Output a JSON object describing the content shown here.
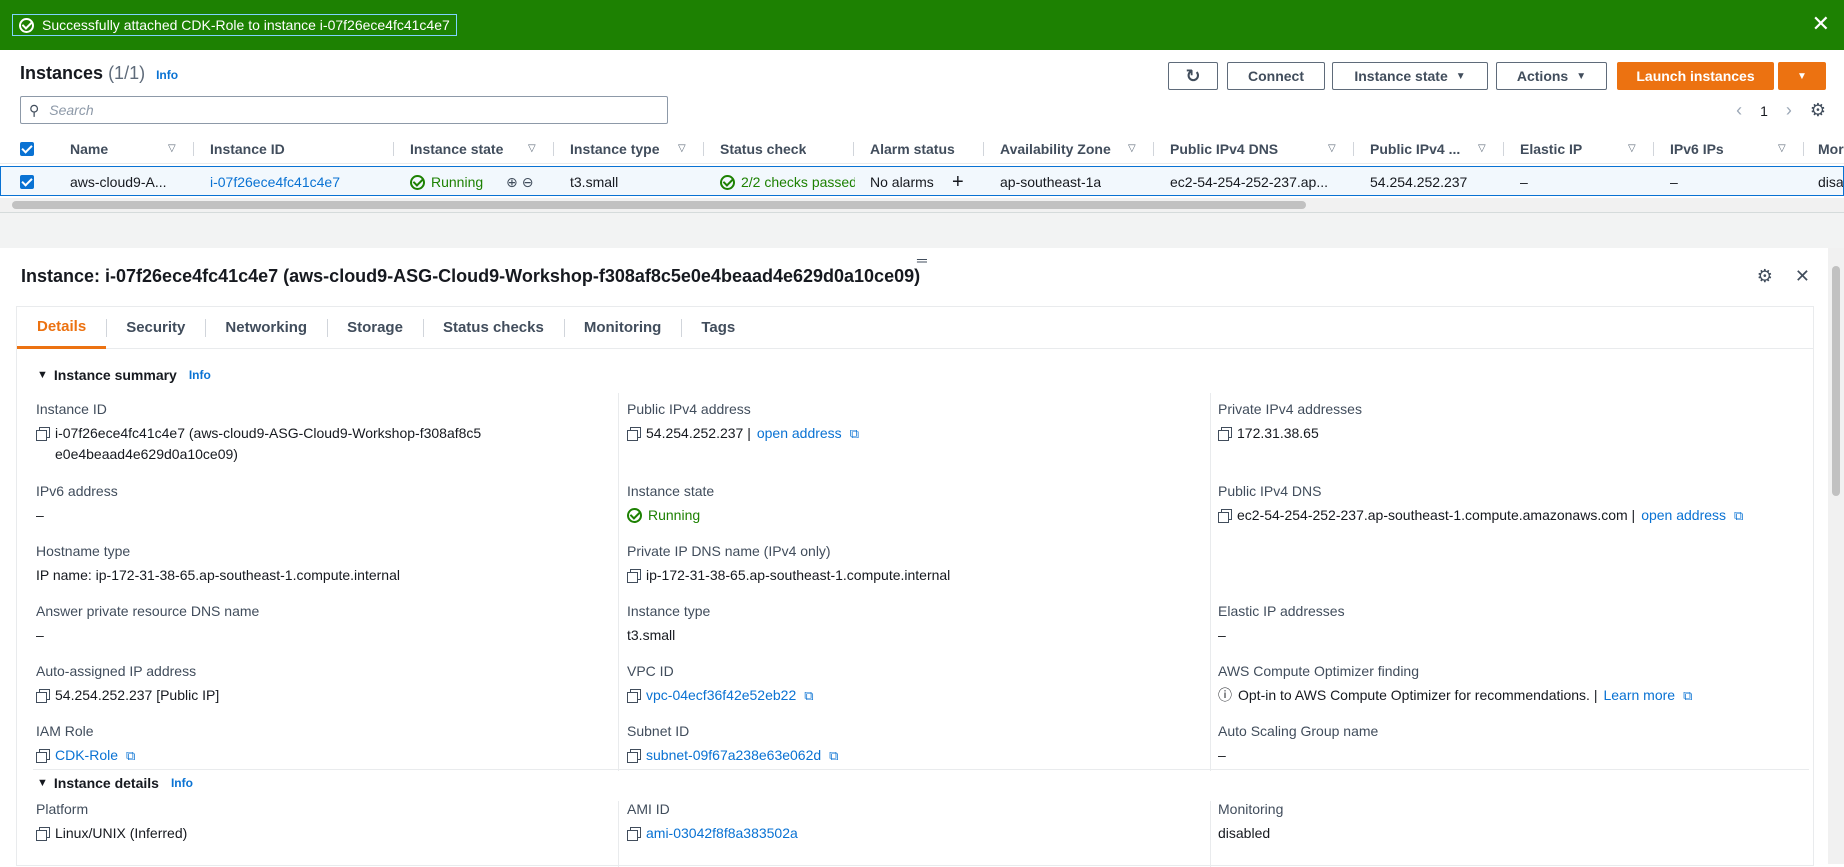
{
  "flash": {
    "message": "Successfully attached CDK-Role to instance i-07f26ece4fc41c4e7",
    "close": "✕"
  },
  "header": {
    "title": "Instances",
    "count": "(1/1)",
    "info": "Info",
    "buttons": {
      "connect": "Connect",
      "instance_state": "Instance state",
      "actions": "Actions",
      "launch": "Launch instances"
    },
    "search_placeholder": "Search",
    "page": "1"
  },
  "table": {
    "columns": [
      "Name",
      "Instance ID",
      "Instance state",
      "Instance type",
      "Status check",
      "Alarm status",
      "Availability Zone",
      "Public IPv4 DNS",
      "Public IPv4 ...",
      "Elastic IP",
      "IPv6 IPs",
      "Mor"
    ],
    "row": {
      "name": "aws-cloud9-A...",
      "instance_id": "i-07f26ece4fc41c4e7",
      "state": "Running",
      "type": "t3.small",
      "status_check": "2/2 checks passed",
      "alarm": "No alarms",
      "az": "ap-southeast-1a",
      "dns": "ec2-54-254-252-237.ap...",
      "ipv4": "54.254.252.237",
      "elastic_ip": "–",
      "ipv6": "–",
      "more": "disa"
    }
  },
  "detail": {
    "title": "Instance: i-07f26ece4fc41c4e7 (aws-cloud9-ASG-Cloud9-Workshop-f308af8c5e0e4beaad4e629d0a10ce09)",
    "tabs": [
      "Details",
      "Security",
      "Networking",
      "Storage",
      "Status checks",
      "Monitoring",
      "Tags"
    ],
    "summary_title": "Instance summary",
    "details_title": "Instance details",
    "info": "Info",
    "fields": {
      "instance_id_label": "Instance ID",
      "instance_id_value": "i-07f26ece4fc41c4e7 (aws-cloud9-ASG-Cloud9-Workshop-f308af8c5e0e4beaad4e629d0a10ce09)",
      "public_ipv4_label": "Public IPv4 address",
      "public_ipv4_value": "54.254.252.237 |",
      "open_address": "open address",
      "private_ipv4_label": "Private IPv4 addresses",
      "private_ipv4_value": "172.31.38.65",
      "ipv6_label": "IPv6 address",
      "ipv6_value": "–",
      "state_label": "Instance state",
      "state_value": "Running",
      "public_dns_label": "Public IPv4 DNS",
      "public_dns_value": "ec2-54-254-252-237.ap-southeast-1.compute.amazonaws.com |",
      "hostname_label": "Hostname type",
      "hostname_value": "IP name: ip-172-31-38-65.ap-southeast-1.compute.internal",
      "private_dns_label": "Private IP DNS name (IPv4 only)",
      "private_dns_value": "ip-172-31-38-65.ap-southeast-1.compute.internal",
      "answer_dns_label": "Answer private resource DNS name",
      "answer_dns_value": "–",
      "type_label": "Instance type",
      "type_value": "t3.small",
      "elastic_label": "Elastic IP addresses",
      "elastic_value": "–",
      "auto_ip_label": "Auto-assigned IP address",
      "auto_ip_value": "54.254.252.237 [Public IP]",
      "vpc_label": "VPC ID",
      "vpc_value": "vpc-04ecf36f42e52eb22",
      "optimizer_label": "AWS Compute Optimizer finding",
      "optimizer_value": "Opt-in to AWS Compute Optimizer for recommendations. |",
      "learn_more": "Learn more",
      "iam_label": "IAM Role",
      "iam_value": "CDK-Role",
      "subnet_label": "Subnet ID",
      "subnet_value": "subnet-09f67a238e63e062d",
      "asg_label": "Auto Scaling Group name",
      "asg_value": "–",
      "platform_label": "Platform",
      "platform_value": "Linux/UNIX (Inferred)",
      "ami_label": "AMI ID",
      "ami_value": "ami-03042f8f8a383502a",
      "monitoring_label": "Monitoring",
      "monitoring_value": "disabled"
    }
  }
}
